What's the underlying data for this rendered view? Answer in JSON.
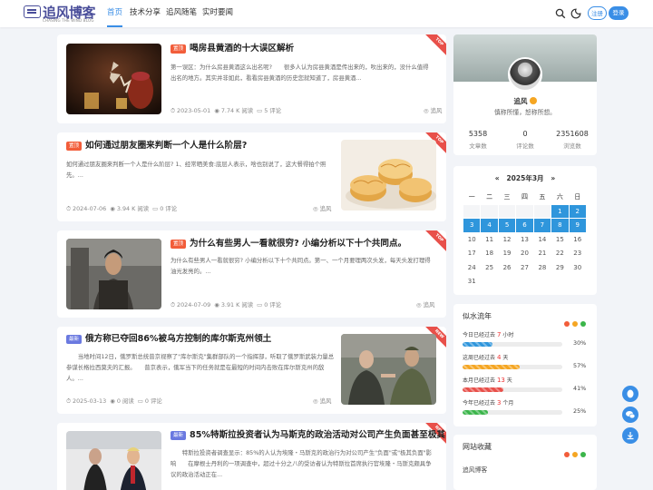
{
  "header": {
    "logo_title": "追风博客",
    "logo_subtitle": "CHASING THE WIND BLOG",
    "nav": [
      "首页",
      "技术分享",
      "追风随笔",
      "实时要闻"
    ],
    "login_label": "注册",
    "register_label": "登录"
  },
  "posts": [
    {
      "title": "喝房县黄酒的十大误区解析",
      "tag": "置顶",
      "excerpt": "第一误区：为什么房县黄酒这么出名呢?　　很多人认为房县黄酒是传出来的，吹出来的，没什么值得出名的地方。其实并非如此，看看房县黄酒的历史您就知道了，房县黄酒...",
      "date": "2023-05-01",
      "views": "7.74 K 阅读",
      "comments": "5 评论",
      "author": "追风",
      "ribbon": "TOP"
    },
    {
      "title": "如何通过朋友圈来判断一个人是什么阶层?",
      "tag": "置顶",
      "excerpt": "如何通过朋友圈来判断一个人是什么阶层? 1、经常晒美食:底层人表示，啥也别说了，这大餐得拍个照先。...",
      "date": "2024-07-06",
      "views": "3.94 K 阅读",
      "comments": "0 评论",
      "author": "追风",
      "ribbon": "TOP"
    },
    {
      "title": "为什么有些男人一看就很穷? 小编分析以下十个共同点。",
      "tag": "置顶",
      "excerpt": "为什么有些男人一看就很穷? 小编分析以下十个共同点。第一、一个月要理两次头发，每天头发打理得油光发亮的。...",
      "date": "2024-07-09",
      "views": "3.91 K 阅读",
      "comments": "0 评论",
      "author": "追风",
      "ribbon": "TOP"
    },
    {
      "title": "俄方称已夺回86%被乌方控制的库尔斯克州领土",
      "tag": "最新",
      "excerpt": "　　当地时间12日，俄罗斯总统普京视察了\"库尔斯克\"集群部队的一个指挥部，听取了俄罗斯武装力量总参谋长格拉西莫夫的汇报。　　普京表示，俄军当下的任务就是在最短的时间内击败在库尔斯克州的敌人。...",
      "date": "2025-03-13",
      "views": "0 阅读",
      "comments": "0 评论",
      "author": "追风",
      "ribbon": "NEW"
    },
    {
      "title": "85%特斯拉投资者认为马斯克的政治活动对公司产生负面甚至极其...",
      "tag": "最新",
      "excerpt": "　　特斯拉投资者调查显示：85%的人认为埃隆・马斯克的政治行为对公司产生\"负面\"或\"极其负面\"影响　　在摩根士丹利的一项调查中，超过十分之八的受访者认为特斯拉首席执行官埃隆・马斯克颇具争议的政治活动正在...",
      "ribbon": "NEW"
    }
  ],
  "profile": {
    "name": "追风",
    "motto": "慎称所懂，恕称所想。",
    "stats": [
      {
        "value": "5358",
        "label": "文章数"
      },
      {
        "value": "0",
        "label": "评论数"
      },
      {
        "value": "2351608",
        "label": "浏览数"
      }
    ]
  },
  "calendar": {
    "title": "2025年3月",
    "weekdays": [
      "一",
      "二",
      "三",
      "四",
      "五",
      "六",
      "日"
    ],
    "highlighted_days": [
      1,
      2,
      3,
      4,
      5,
      6,
      7,
      8,
      9
    ]
  },
  "flow": {
    "title": "似水流年",
    "dot_colors": [
      "#f25d3a",
      "#f5a623",
      "#3bb54a"
    ],
    "items": [
      {
        "prefix": "今日已经过去",
        "num": "7",
        "unit": " 小时",
        "percent": 30,
        "pct_label": "30%",
        "color": "#2f96dc"
      },
      {
        "prefix": "这周已经过去",
        "num": "4",
        "unit": " 天",
        "percent": 57,
        "pct_label": "57%",
        "color": "#f5a623"
      },
      {
        "prefix": "本月已经过去",
        "num": "13",
        "unit": " 天",
        "percent": 41,
        "pct_label": "41%",
        "color": "#e8504a"
      },
      {
        "prefix": "今年已经过去",
        "num": "3",
        "unit": " 个月",
        "percent": 25,
        "pct_label": "25%",
        "color": "#3bb54a"
      }
    ]
  },
  "links": {
    "title": "网站收藏",
    "items": [
      "追风博客"
    ]
  }
}
